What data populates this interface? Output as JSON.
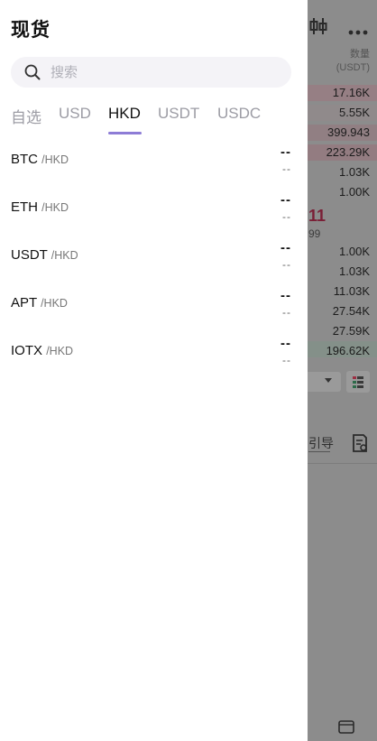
{
  "drawer": {
    "title": "现货",
    "search": {
      "placeholder": "搜索",
      "value": ""
    },
    "tabs": [
      {
        "label": "自选",
        "active": false
      },
      {
        "label": "USD",
        "active": false
      },
      {
        "label": "HKD",
        "active": true
      },
      {
        "label": "USDT",
        "active": false
      },
      {
        "label": "USDC",
        "active": false
      }
    ],
    "pairs": [
      {
        "base": "BTC",
        "quote": "/HKD",
        "price": "--",
        "change": "--"
      },
      {
        "base": "ETH",
        "quote": "/HKD",
        "price": "--",
        "change": "--"
      },
      {
        "base": "USDT",
        "quote": "/HKD",
        "price": "--",
        "change": "--"
      },
      {
        "base": "APT",
        "quote": "/HKD",
        "price": "--",
        "change": "--"
      },
      {
        "base": "IOTX",
        "quote": "/HKD",
        "price": "--",
        "change": "--"
      }
    ],
    "accent_color": "#8d7cd6"
  },
  "background": {
    "qty_header": "数量",
    "qty_unit": "(USDT)",
    "asks": [
      "17.16K",
      "5.55K",
      "399.943",
      "223.29K",
      "1.03K",
      "1.00K"
    ],
    "last_price_fragment": "11",
    "last_price_sub_fragment": "99",
    "bids": [
      "1.00K",
      "1.03K",
      "11.03K",
      "27.54K",
      "27.59K",
      "196.62K"
    ],
    "guide_fragment": "引导",
    "icons": [
      "candlestick-icon",
      "more-icon",
      "order-book-icon",
      "document-icon",
      "wallet-icon"
    ]
  }
}
